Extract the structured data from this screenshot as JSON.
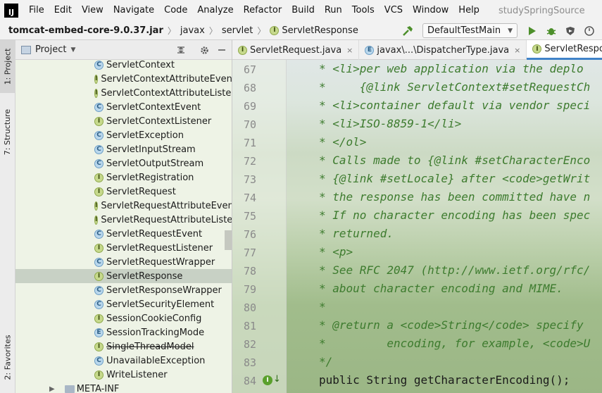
{
  "menubar": {
    "items": [
      "File",
      "Edit",
      "View",
      "Navigate",
      "Code",
      "Analyze",
      "Refactor",
      "Build",
      "Run",
      "Tools",
      "VCS",
      "Window",
      "Help"
    ],
    "window_title": "studySpringSource"
  },
  "navbar": {
    "jar": "tomcat-embed-core-9.0.37.jar",
    "package": "javax",
    "subpackage": "servlet",
    "current": "ServletResponse",
    "run_config": "DefaultTestMain"
  },
  "stripe": {
    "project": "1: Project",
    "structure": "7: Structure",
    "favorites": "2: Favorites"
  },
  "project_panel": {
    "title": "Project",
    "items": [
      {
        "kind": "C",
        "label": "ServletContext"
      },
      {
        "kind": "I",
        "label": "ServletContextAttributeEvent"
      },
      {
        "kind": "I",
        "label": "ServletContextAttributeListener"
      },
      {
        "kind": "C",
        "label": "ServletContextEvent"
      },
      {
        "kind": "I",
        "label": "ServletContextListener"
      },
      {
        "kind": "C",
        "label": "ServletException"
      },
      {
        "kind": "C",
        "label": "ServletInputStream"
      },
      {
        "kind": "C",
        "label": "ServletOutputStream"
      },
      {
        "kind": "I",
        "label": "ServletRegistration"
      },
      {
        "kind": "I",
        "label": "ServletRequest"
      },
      {
        "kind": "I",
        "label": "ServletRequestAttributeEvent"
      },
      {
        "kind": "I",
        "label": "ServletRequestAttributeListener"
      },
      {
        "kind": "C",
        "label": "ServletRequestEvent"
      },
      {
        "kind": "I",
        "label": "ServletRequestListener"
      },
      {
        "kind": "C",
        "label": "ServletRequestWrapper"
      },
      {
        "kind": "I",
        "label": "ServletResponse",
        "selected": true
      },
      {
        "kind": "C",
        "label": "ServletResponseWrapper"
      },
      {
        "kind": "C",
        "label": "ServletSecurityElement"
      },
      {
        "kind": "I",
        "label": "SessionCookieConfig"
      },
      {
        "kind": "E",
        "label": "SessionTrackingMode"
      },
      {
        "kind": "I",
        "label": "SingleThreadModel",
        "strike": true
      },
      {
        "kind": "C",
        "label": "UnavailableException"
      },
      {
        "kind": "I",
        "label": "WriteListener"
      }
    ],
    "folder": "META-INF"
  },
  "tabs": [
    {
      "icon": "I",
      "label": "ServletRequest.java",
      "close": "×"
    },
    {
      "icon": "E",
      "label": "javax\\...\\DispatcherType.java",
      "close": "×"
    },
    {
      "icon": "I",
      "label": "ServletResponse.java",
      "active": true
    }
  ],
  "code": {
    "lines": [
      {
        "n": "67",
        "text": "* <li>per web application via the deplo"
      },
      {
        "n": "68",
        "text": "*     {@link ServletContext#setRequestCh"
      },
      {
        "n": "69",
        "text": "* <li>container default via vendor speci"
      },
      {
        "n": "70",
        "text": "* <li>ISO-8859-1</li>"
      },
      {
        "n": "71",
        "text": "* </ol>"
      },
      {
        "n": "72",
        "text": "* Calls made to {@link #setCharacterEnco"
      },
      {
        "n": "73",
        "text": "* {@link #setLocale} after <code>getWrit"
      },
      {
        "n": "74",
        "text": "* the response has been committed have n"
      },
      {
        "n": "75",
        "text": "* If no character encoding has been spec"
      },
      {
        "n": "76",
        "text": "* returned."
      },
      {
        "n": "77",
        "text": "* <p>"
      },
      {
        "n": "78",
        "text": "* See RFC 2047 (http://www.ietf.org/rfc/"
      },
      {
        "n": "79",
        "text": "* about character encoding and MIME."
      },
      {
        "n": "80",
        "text": "*"
      },
      {
        "n": "81",
        "text": "* @return a <code>String</code> specify"
      },
      {
        "n": "82",
        "text": "*         encoding, for example, <code>U"
      },
      {
        "n": "83",
        "text": "*/"
      },
      {
        "n": "84",
        "text": "public String getCharacterEncoding();"
      }
    ]
  }
}
